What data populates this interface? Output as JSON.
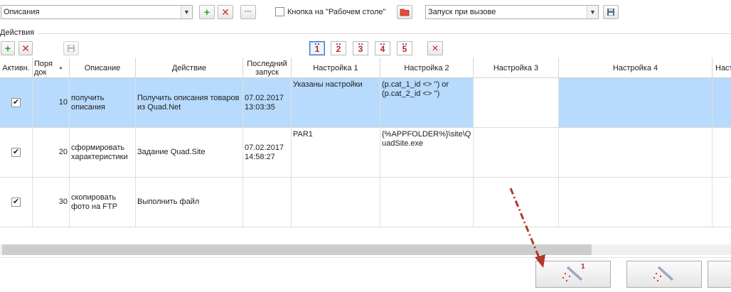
{
  "top": {
    "descriptions_combo": "Описания",
    "desktop_checkbox_label": "Кнопка на \"Рабочем столе\"",
    "launch_combo": "Запуск при вызове"
  },
  "section": {
    "title": "Действия",
    "number_buttons": [
      "1",
      "2",
      "3",
      "4",
      "5"
    ]
  },
  "grid": {
    "headers": {
      "active": "Активн.",
      "order": "Поря\nдок",
      "sort_arrow": "▲",
      "description": "Описание",
      "action": "Действие",
      "last_run": "Последний\nзапуск",
      "setting1": "Настройка 1",
      "setting2": "Настройка 2",
      "setting3": "Настройка 3",
      "setting4": "Настройка 4",
      "setting5": "Наст"
    },
    "rows": [
      {
        "active": true,
        "order": "10",
        "description": "получить\nописания",
        "action": "Получить описания товаров\nиз Quad.Net",
        "last_run": "07.02.2017\n13:03:35",
        "setting1": "Указаны настройки",
        "setting2": "(p.cat_1_id <> '') or\n(p.cat_2_id <> '')",
        "setting3": "",
        "setting4": ""
      },
      {
        "active": true,
        "order": "20",
        "description": "сформировать\nхарактеристики",
        "action": "Задание Quad.Site",
        "last_run": "07.02.2017\n14:58:27",
        "setting1": "PAR1",
        "setting2": "{%APPFOLDER%}\\site\\Q\nuadSite.exe",
        "setting3": "",
        "setting4": ""
      },
      {
        "active": true,
        "order": "30",
        "description": "скопировать\nфото на FTP",
        "action": "Выполнить файл",
        "last_run": "",
        "setting1": "",
        "setting2": "",
        "setting3": "",
        "setting4": ""
      }
    ]
  },
  "bottom": {
    "button1_badge": "1"
  },
  "colors": {
    "selection": "#b8dafc",
    "accent_red": "#c21f1f",
    "arrow": "#b0392b"
  }
}
